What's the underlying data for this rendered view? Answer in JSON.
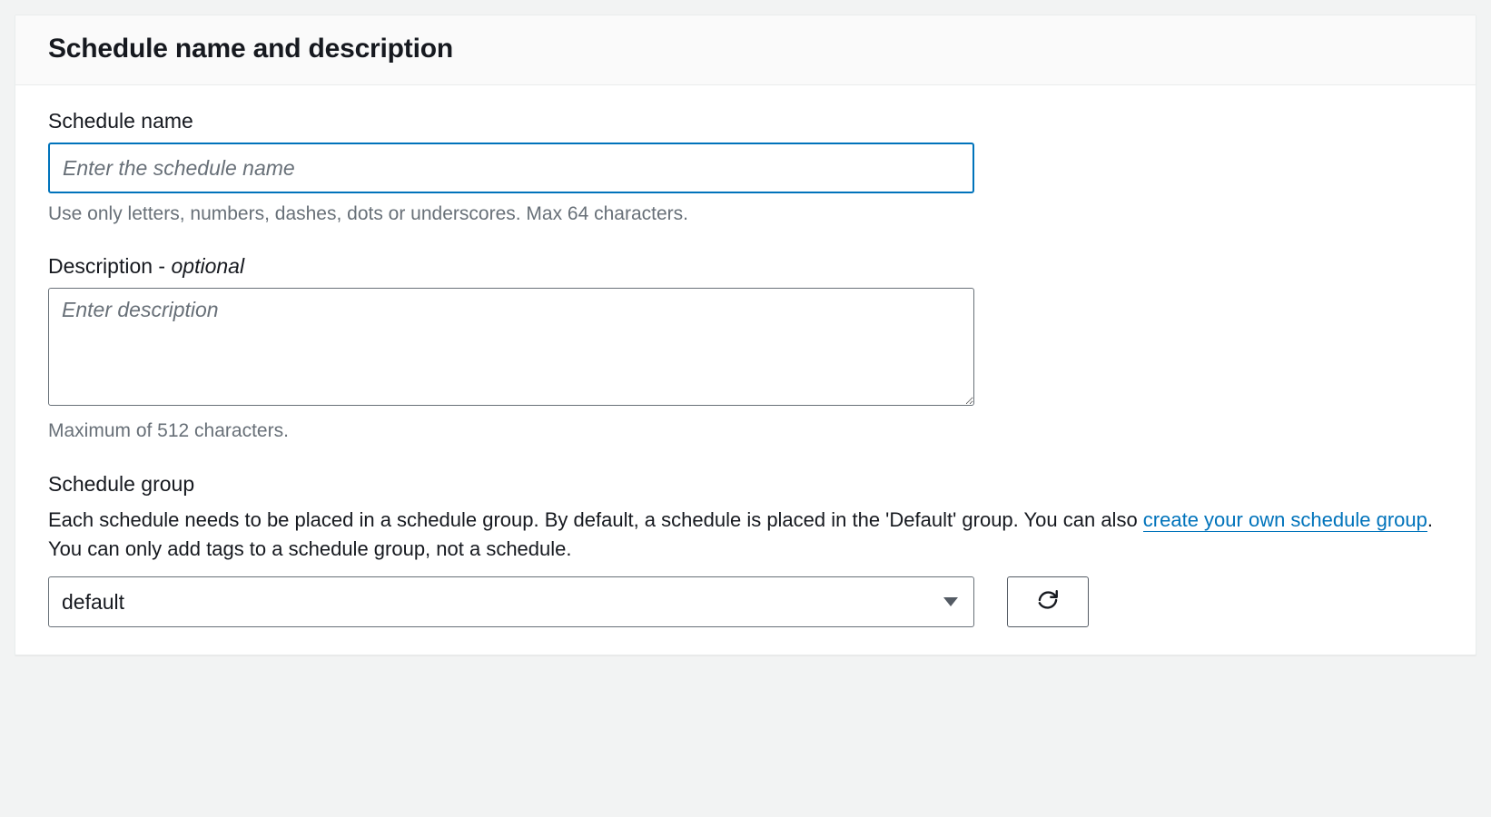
{
  "panel": {
    "title": "Schedule name and description"
  },
  "schedule_name": {
    "label": "Schedule name",
    "placeholder": "Enter the schedule name",
    "value": "",
    "hint": "Use only letters, numbers, dashes, dots or underscores. Max 64 characters."
  },
  "description": {
    "label_prefix": "Description - ",
    "label_optional": "optional",
    "placeholder": "Enter description",
    "value": "",
    "hint": "Maximum of 512 characters."
  },
  "schedule_group": {
    "label": "Schedule group",
    "description_part1": "Each schedule needs to be placed in a schedule group. By default, a schedule is placed in the 'Default' group. You can also ",
    "link_text": "create your own schedule group",
    "description_part2": ". You can only add tags to a schedule group, not a schedule.",
    "selected": "default"
  }
}
